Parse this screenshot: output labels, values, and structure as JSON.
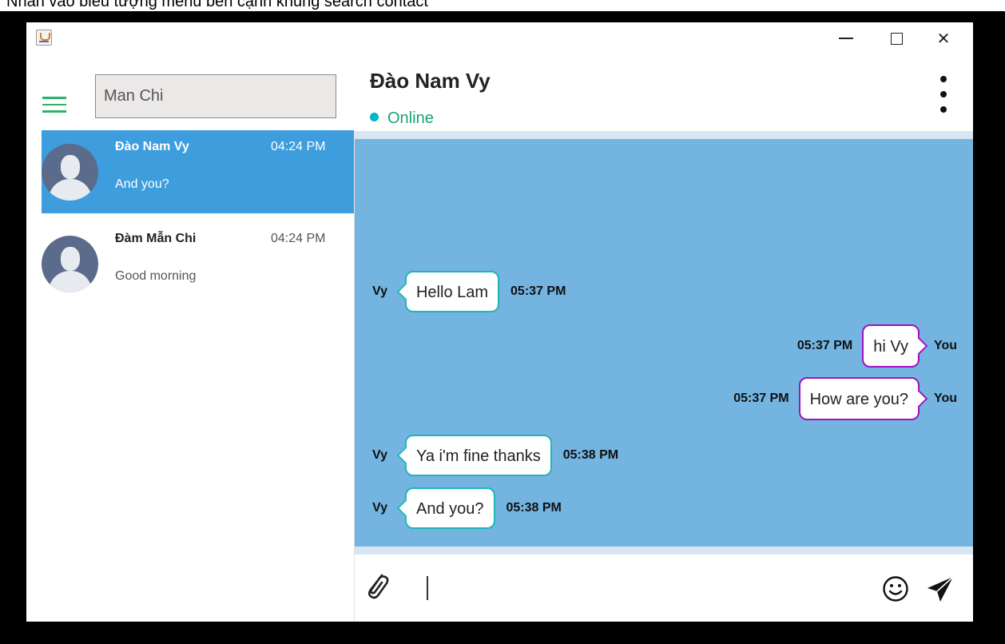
{
  "caption": "Nhấn vào biểu tượng menu bên cạnh khung search contact",
  "search": {
    "value": "Man Chi"
  },
  "contacts": [
    {
      "name": "Đào Nam Vy",
      "time": "04:24 PM",
      "last": "And you?"
    },
    {
      "name": "Đàm Mẫn Chi",
      "time": "04:24 PM",
      "last": "Good morning"
    }
  ],
  "chat": {
    "title": "Đào Nam Vy",
    "status": "Online",
    "messages": [
      {
        "sender": "Vy",
        "text": "Hello Lam",
        "time": "05:37 PM"
      },
      {
        "sender": "You",
        "text": "hi Vy",
        "time": "05:37 PM"
      },
      {
        "sender": "You",
        "text": "How are you?",
        "time": "05:37 PM"
      },
      {
        "sender": "Vy",
        "text": "Ya i'm fine thanks",
        "time": "05:38 PM"
      },
      {
        "sender": "Vy",
        "text": "And you?",
        "time": "05:38 PM"
      }
    ]
  },
  "colors": {
    "chat_background": "#73b4e0",
    "active_contact": "#3e9ddd",
    "incoming_border": "#1fb6b6",
    "outgoing_border": "#a012c0",
    "menu_icon": "#2fb36a",
    "online": "#1aa36e"
  },
  "icons": [
    "app-icon",
    "menu-icon",
    "avatar-icon",
    "kebab-menu-icon",
    "paperclip-icon",
    "emoji-icon",
    "send-icon",
    "minimize-icon",
    "maximize-icon",
    "close-icon"
  ]
}
